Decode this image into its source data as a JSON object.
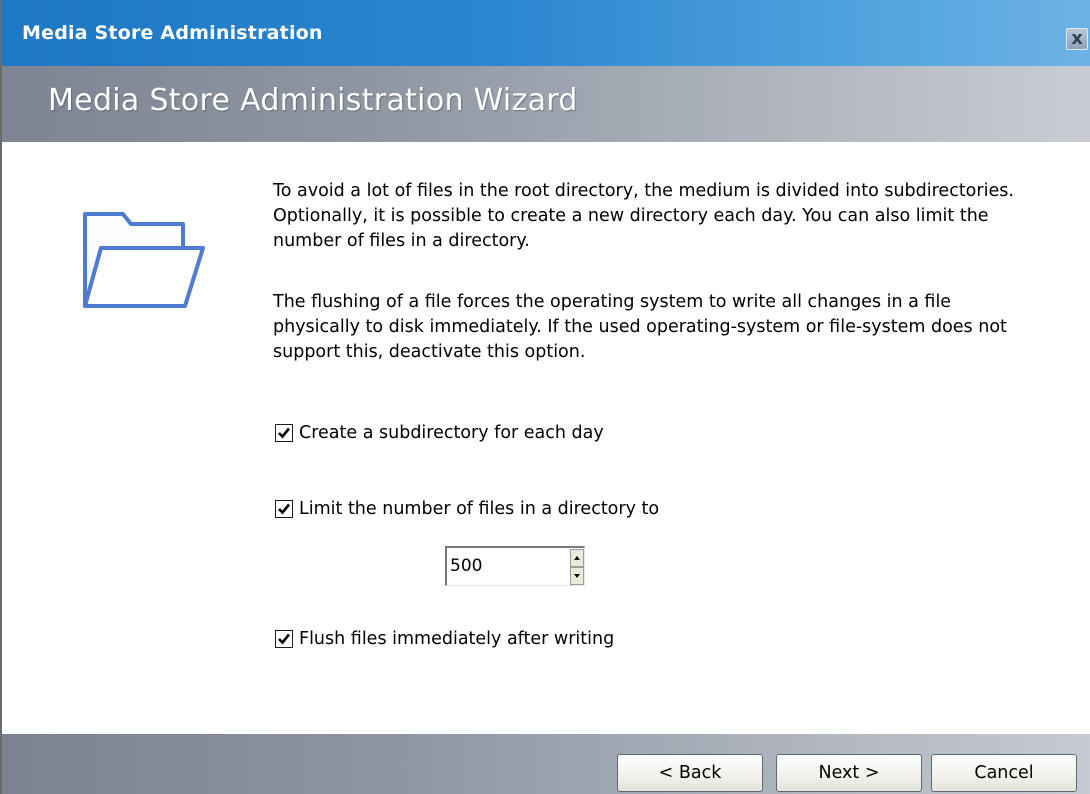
{
  "window": {
    "title": "Media Store Administration",
    "close_glyph": "x",
    "close_icon": "close-icon"
  },
  "wizard": {
    "header_title": "Media Store Administration Wizard",
    "icon": "folder-icon"
  },
  "content": {
    "paragraph1": "To avoid a lot of files in the root directory, the medium is divided into subdirectories. Optionally, it is possible to create a new directory each day. You can also limit the number of files in a directory.",
    "paragraph2": "The flushing of a file forces the operating system to write all changes in a file physically to disk immediately. If the used operating-system or file-system does not support this, deactivate this option.",
    "options": [
      {
        "label": "Create a subdirectory for each day",
        "checked": true
      },
      {
        "label": "Limit the number of files in a directory to",
        "checked": true
      },
      {
        "label": "Flush files immediately after writing",
        "checked": true
      }
    ],
    "file_limit": {
      "value": "500"
    }
  },
  "footer": {
    "back_label": "< Back",
    "next_label": "Next >",
    "cancel_label": "Cancel"
  },
  "colors": {
    "titlebar_accent": "#1e78c4",
    "header_gray": "#8f97a4",
    "folder_blue": "#4f7bd1"
  }
}
